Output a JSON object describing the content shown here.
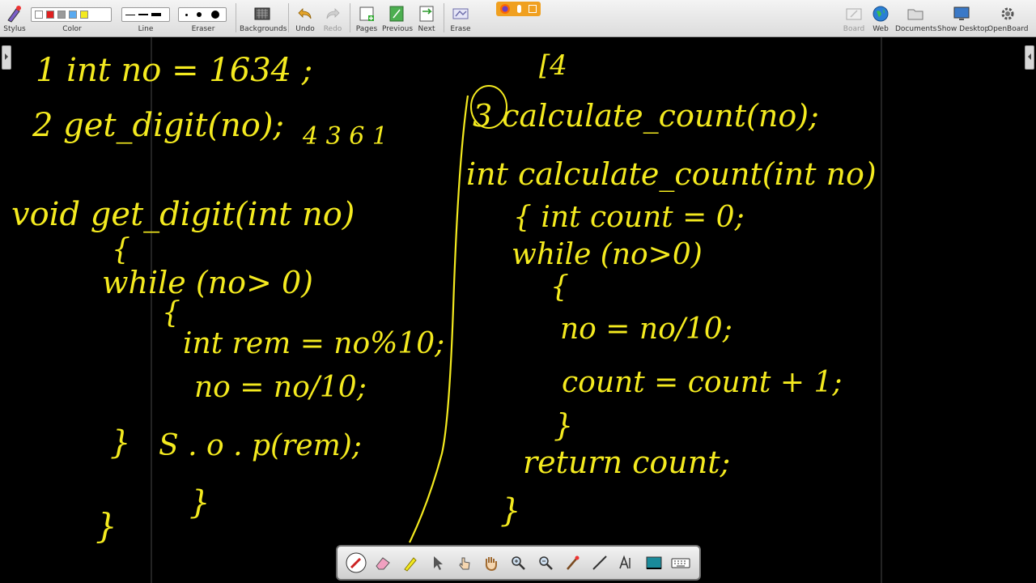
{
  "toolbar": {
    "stylus": "Stylus",
    "color": "Color",
    "line": "Line",
    "eraser": "Eraser",
    "backgrounds": "Backgrounds",
    "undo": "Undo",
    "redo": "Redo",
    "pages": "Pages",
    "previous": "Previous",
    "next": "Next",
    "erase": "Erase",
    "board": "Board",
    "web": "Web",
    "documents": "Documents",
    "show_desktop": "Show Desktop",
    "openboard": "OpenBoard"
  },
  "colors": {
    "ink": "#f4ea1f",
    "swatches": [
      "#ffffff",
      "#e02020",
      "#9a9a9a",
      "#5aaaf0",
      "#f4ea1f"
    ]
  },
  "board": {
    "left": {
      "line1": "1 int no = 1634 ;",
      "line2": "2 get_digit(no);",
      "digits": "4  3  6  1",
      "func_sig": "void get_digit(int no)",
      "open_brace": "{",
      "while_line": "while (no> 0)",
      "inner_open": "{",
      "rem_line": "int  rem = no%10;",
      "div_line": "no = no/10;",
      "close_brace_inner": "}",
      "sop_line": "S . o . p(rem);",
      "sop_close": "}",
      "func_close": "}"
    },
    "right": {
      "top_mark": "[4",
      "call_line": "3 calculate_count(no);",
      "func_sig": "int calculate_count(int no)",
      "decl_line": "{   int  count = 0;",
      "while_line": "while (no>0)",
      "inner_open": "{",
      "div_line": "no = no/10;",
      "count_line": "count = count + 1;",
      "inner_close": "}",
      "return_line": "return  count;",
      "func_close": "}"
    }
  },
  "palette": {
    "tools": [
      "pen-tool",
      "eraser-tool",
      "marker-tool",
      "selector-tool",
      "interact-tool",
      "hand-tool",
      "zoom-in-tool",
      "zoom-out-tool",
      "laser-tool",
      "line-tool",
      "text-tool",
      "capture-tool",
      "keyboard-tool"
    ]
  }
}
